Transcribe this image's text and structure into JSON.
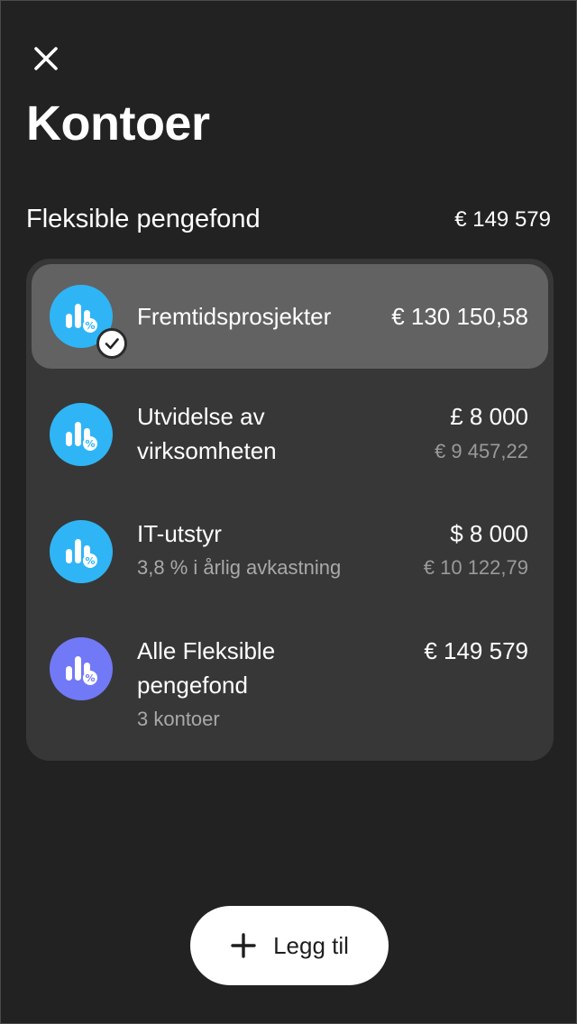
{
  "header": {
    "title": "Kontoer"
  },
  "section": {
    "title": "Fleksible pengefond",
    "total": "€ 149 579"
  },
  "accounts": [
    {
      "name": "Fremtidsprosjekter",
      "amount": "€ 130 150,58",
      "selected": true,
      "icon_color": "#2fb5f5"
    },
    {
      "name_line1": "Utvidelse av",
      "name_line2": "virksomheten",
      "amount": "£ 8 000",
      "converted": "€ 9 457,22",
      "icon_color": "#2fb5f5"
    },
    {
      "name": "IT-utstyr",
      "subtitle": "3,8 % i årlig avkastning",
      "amount": "$ 8 000",
      "converted": "€ 10 122,79",
      "icon_color": "#2fb5f5"
    },
    {
      "name_line1": "Alle Fleksible",
      "name_line2": "pengefond",
      "subtitle": "3 kontoer",
      "amount": "€ 149 579",
      "icon_color": "#7179f6"
    }
  ],
  "actions": {
    "add_label": "Legg til"
  },
  "icons": {
    "close": "close-icon",
    "fund": "fund-chart-percent-icon",
    "check": "check-icon",
    "plus": "plus-icon"
  }
}
